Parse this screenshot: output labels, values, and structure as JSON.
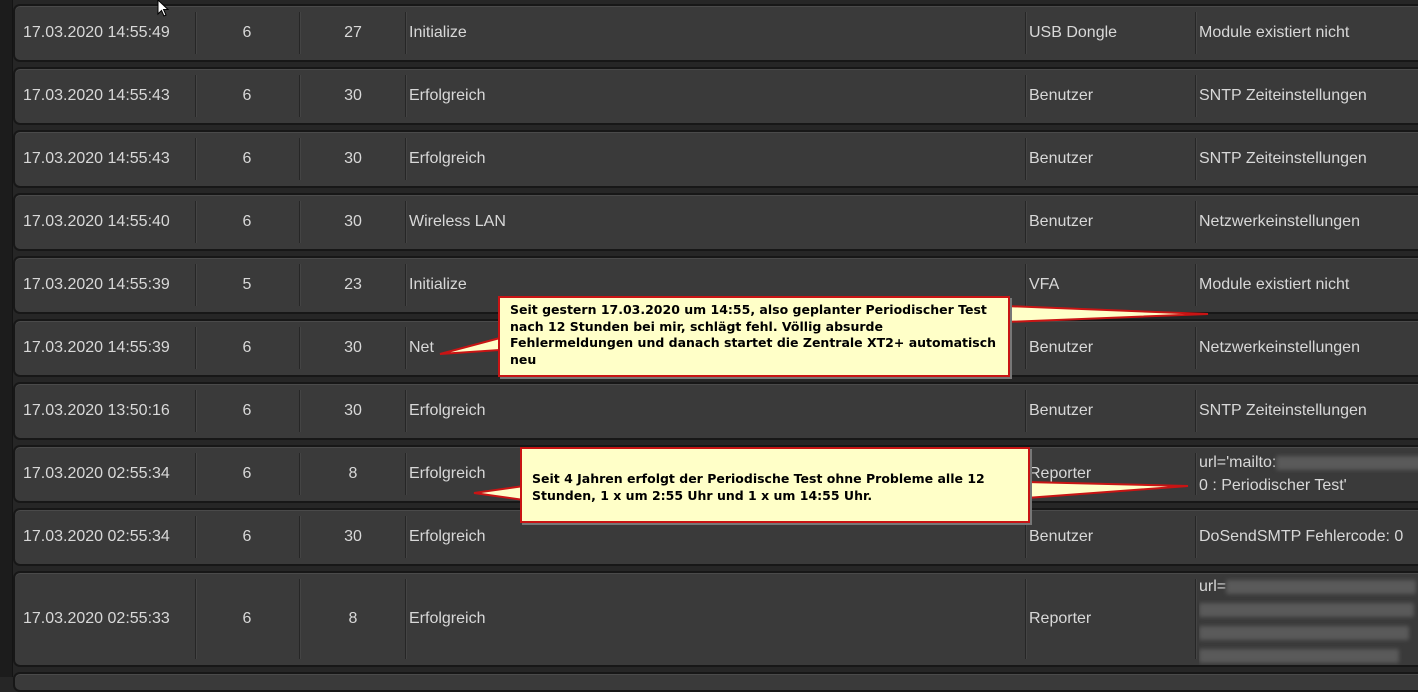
{
  "log": {
    "rows": [
      {
        "date": "17.03.2020 14:55:49",
        "a": "6",
        "b": "27",
        "event": "Initialize",
        "source": "USB Dongle",
        "info": "Module existiert nicht"
      },
      {
        "date": "17.03.2020 14:55:43",
        "a": "6",
        "b": "30",
        "event": "Erfolgreich",
        "source": "Benutzer",
        "info": "SNTP Zeiteinstellungen"
      },
      {
        "date": "17.03.2020 14:55:43",
        "a": "6",
        "b": "30",
        "event": "Erfolgreich",
        "source": "Benutzer",
        "info": "SNTP Zeiteinstellungen"
      },
      {
        "date": "17.03.2020 14:55:40",
        "a": "6",
        "b": "30",
        "event": "Wireless LAN",
        "source": "Benutzer",
        "info": "Netzwerkeinstellungen"
      },
      {
        "date": "17.03.2020 14:55:39",
        "a": "5",
        "b": "23",
        "event": "Initialize",
        "source": "VFA",
        "info": "Module existiert nicht"
      },
      {
        "date": "17.03.2020 14:55:39",
        "a": "6",
        "b": "30",
        "event": "Net",
        "source": "Benutzer",
        "info": "Netzwerkeinstellungen"
      },
      {
        "date": "17.03.2020 13:50:16",
        "a": "6",
        "b": "30",
        "event": "Erfolgreich",
        "source": "Benutzer",
        "info": "SNTP Zeiteinstellungen"
      },
      {
        "date": "17.03.2020 02:55:34",
        "a": "6",
        "b": "8",
        "event": "Erfolgreich",
        "source": "Reporter",
        "info_line1": "url='mailto:",
        "info_line2": "0 : Periodischer Test'"
      },
      {
        "date": "17.03.2020 02:55:34",
        "a": "6",
        "b": "30",
        "event": "Erfolgreich",
        "source": "Benutzer",
        "info": "DoSendSMTP Fehlercode: 0"
      },
      {
        "date": "17.03.2020 02:55:33",
        "a": "6",
        "b": "8",
        "event": "Erfolgreich",
        "source": "Reporter",
        "info_line1": "url="
      }
    ]
  },
  "callouts": {
    "first": "Seit gestern 17.03.2020 um 14:55, also geplanter Periodischer Test nach 12 Stunden bei mir, schlägt fehl. Völlig absurde Fehlermeldungen und danach startet die Zentrale XT2+ automatisch neu",
    "second": "Seit 4 Jahren erfolgt der Periodische Test ohne Probleme alle 12 Stunden, 1 x um 2:55 Uhr und 1 x um 14:55 Uhr."
  },
  "colors": {
    "callout_bg": "#ffffc8",
    "callout_border": "#c81414",
    "row_bg": "#3a3a3a"
  },
  "icons": {
    "cursor": "mouse-pointer-icon"
  }
}
